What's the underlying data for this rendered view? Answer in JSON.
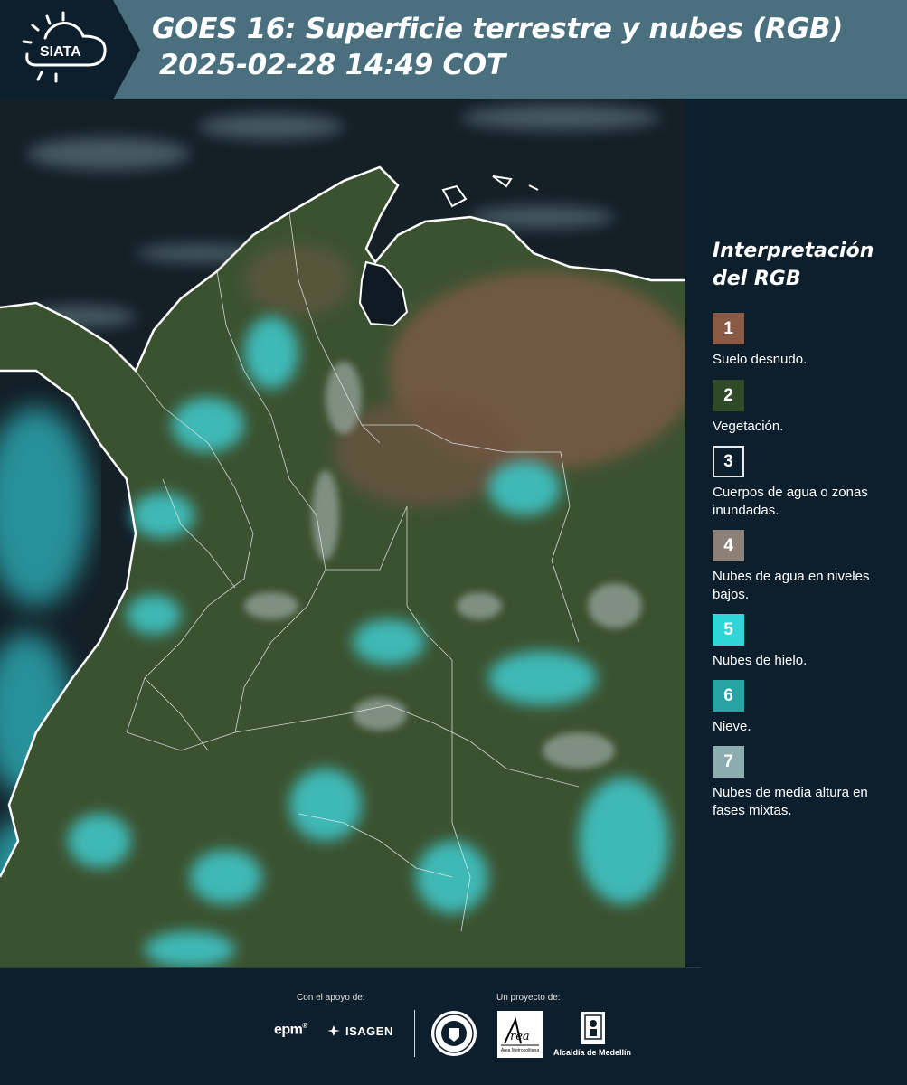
{
  "header": {
    "logo_text": "SIATA",
    "title_line1": "GOES 16: Superficie terrestre y nubes (RGB)",
    "title_line2": "2025-02-28 14:49 COT",
    "background_color": "#4a7080"
  },
  "legend": {
    "title_line1": "Interpretación",
    "title_line2": "del RGB",
    "items": [
      {
        "number": "1",
        "label": "Suelo desnudo.",
        "color": "#8a5a45"
      },
      {
        "number": "2",
        "label": "Vegetación.",
        "color": "#2e4a27"
      },
      {
        "number": "3",
        "label": "Cuerpos de agua o zonas inundadas.",
        "color": "#0d1f2c"
      },
      {
        "number": "4",
        "label": "Nubes de agua en niveles bajos.",
        "color": "#8c8178"
      },
      {
        "number": "5",
        "label": "Nubes de hielo.",
        "color": "#2fd6d8"
      },
      {
        "number": "6",
        "label": "Nieve.",
        "color": "#27a3a3"
      },
      {
        "number": "7",
        "label": "Nubes de media altura en fases mixtas.",
        "color": "#8cadb0"
      }
    ]
  },
  "footer": {
    "support_label": "Con el apoyo de:",
    "project_label": "Un proyecto de:",
    "sponsor_1": "epm",
    "sponsor_2": "ISAGEN",
    "partner_1": "Área Metropolitana",
    "partner_2": "Alcaldía de Medellín"
  }
}
